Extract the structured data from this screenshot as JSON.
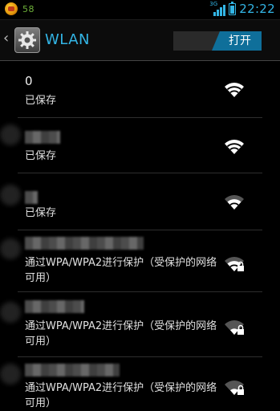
{
  "status_bar": {
    "notification_count": "58",
    "network_type": "3G",
    "time": "22:22",
    "battery_fraction": 0.9
  },
  "action_bar": {
    "title": "WLAN",
    "wifi_toggle_label": "打开"
  },
  "networks": [
    {
      "ssid": "0",
      "status": "已保存",
      "secured": false,
      "signal": "full"
    },
    {
      "ssid": "",
      "status": "已保存",
      "secured": false,
      "signal": "full"
    },
    {
      "ssid": "",
      "status": "已保存",
      "secured": false,
      "signal": "medium"
    },
    {
      "ssid": "",
      "status": "通过WPA/WPA2进行保护（受保护的网络可用）",
      "secured": true,
      "signal": "medium"
    },
    {
      "ssid": "",
      "status": "通过WPA/WPA2进行保护（受保护的网络可用）",
      "secured": true,
      "signal": "weak"
    },
    {
      "ssid": "",
      "status": "通过WPA/WPA2进行保护（受保护的网络可用）",
      "secured": true,
      "signal": "weak"
    }
  ],
  "colors": {
    "accent": "#33b5e5",
    "background": "#000000",
    "notification_green": "#6fb23a"
  }
}
